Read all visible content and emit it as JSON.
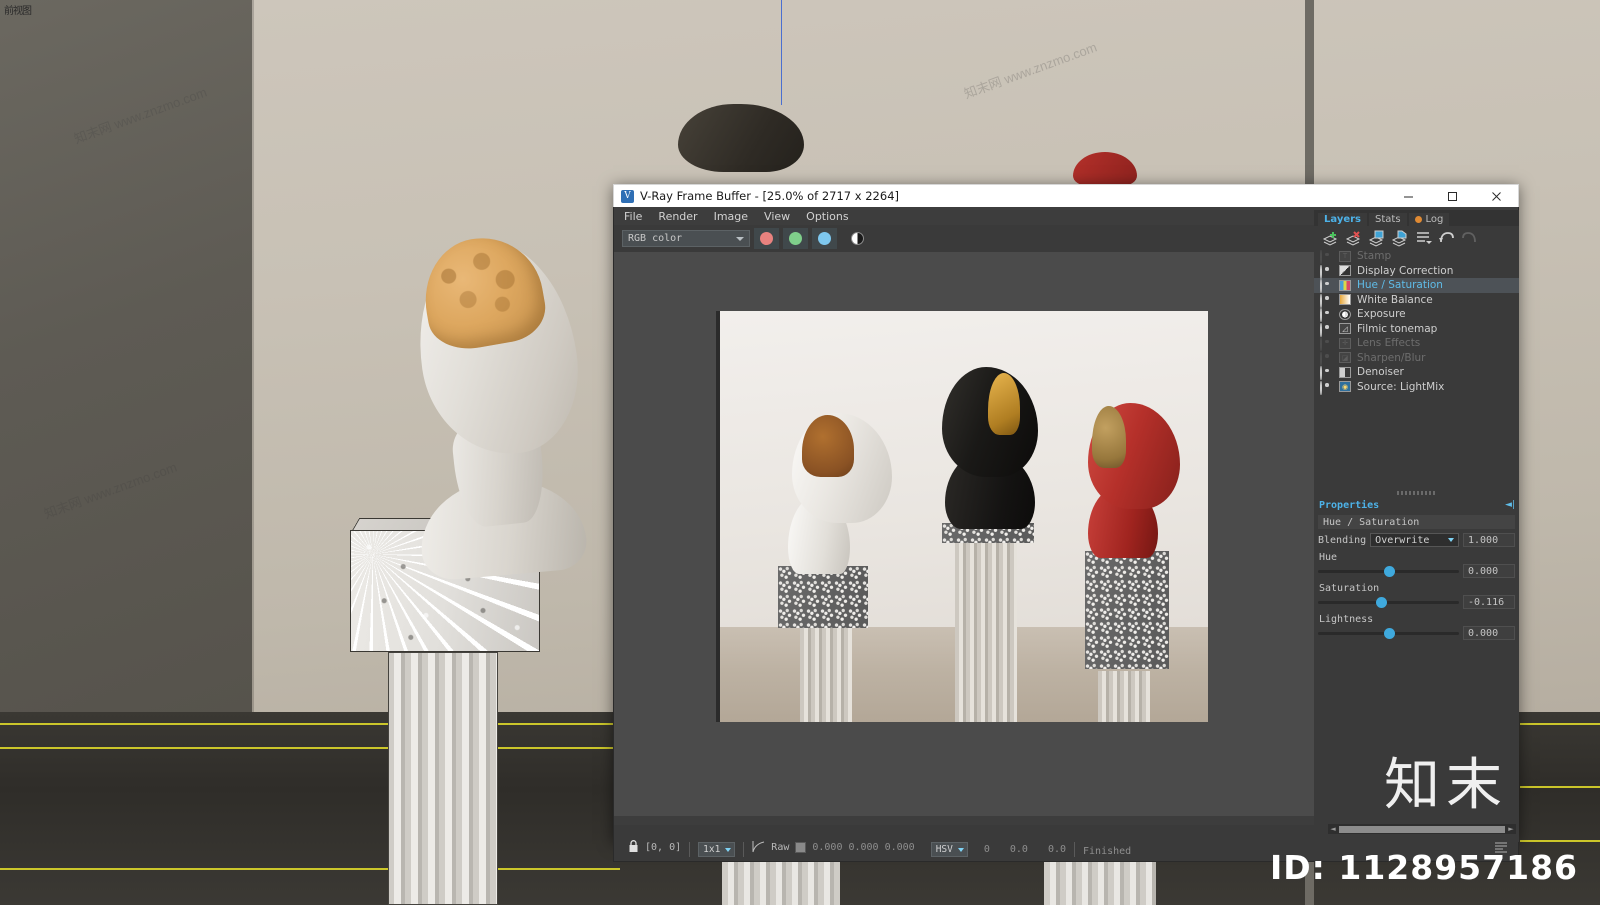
{
  "viewport": {
    "label": "前视图",
    "watermarks": [
      "知末网 www.znzmo.com",
      "知末网 www.znzmo.com",
      "知末网 www.znzmo.com",
      "知末网 www.znzmo.com"
    ],
    "brand_mark": "知末",
    "id_text": "ID: 1128957186"
  },
  "window": {
    "app_icon": "vray-logo-icon",
    "title": "V-Ray Frame Buffer - [25.0% of 2717 x 2264]",
    "controls": {
      "minimize": "–",
      "maximize": "❐",
      "close": "✕"
    }
  },
  "menubar": {
    "items": [
      {
        "label": "File"
      },
      {
        "label": "Render"
      },
      {
        "label": "Image"
      },
      {
        "label": "View"
      },
      {
        "label": "Options"
      }
    ]
  },
  "toolbar": {
    "channel_select": {
      "value": "RGB color"
    },
    "channel_buttons": [
      {
        "name": "red-channel-button",
        "color": "#e8827f"
      },
      {
        "name": "green-channel-button",
        "color": "#7fcf8b"
      },
      {
        "name": "blue-channel-button",
        "color": "#7ec8ef"
      }
    ],
    "mono_button": {
      "name": "alpha-channel-button"
    },
    "right_icons": [
      {
        "name": "save-image-icon"
      },
      {
        "name": "save-image-as-icon"
      },
      {
        "name": "region-render-icon"
      },
      {
        "name": "show-vfb-icon"
      },
      {
        "name": "render-last-icon"
      },
      {
        "name": "stop-render-icon"
      },
      {
        "name": "render-icon"
      }
    ]
  },
  "dock": {
    "tabs": [
      {
        "label": "Layers",
        "active": true
      },
      {
        "label": "Stats",
        "active": false
      },
      {
        "label": "Log",
        "active": false,
        "dot": true
      }
    ],
    "layer_toolbar": [
      {
        "name": "add-layer-icon"
      },
      {
        "name": "delete-layer-icon"
      },
      {
        "name": "load-layer-icon"
      },
      {
        "name": "save-layer-icon"
      },
      {
        "name": "layer-list-icon"
      },
      {
        "name": "undo-icon"
      },
      {
        "name": "redo-icon"
      }
    ],
    "layers": [
      {
        "label": "Stamp",
        "icon": "stamp-icon",
        "enabled": false,
        "selected": false,
        "glyph": "T"
      },
      {
        "label": "Display Correction",
        "icon": "display-correction-icon",
        "enabled": true,
        "selected": false,
        "glyph": "◤"
      },
      {
        "label": "Hue / Saturation",
        "icon": "hue-saturation-icon",
        "enabled": true,
        "selected": true,
        "glyph": "▥"
      },
      {
        "label": "White Balance",
        "icon": "white-balance-icon",
        "enabled": true,
        "selected": false,
        "glyph": "▬"
      },
      {
        "label": "Exposure",
        "icon": "exposure-icon",
        "enabled": true,
        "selected": false,
        "glyph": "◑"
      },
      {
        "label": "Filmic tonemap",
        "icon": "filmic-tonemap-icon",
        "enabled": true,
        "selected": false,
        "glyph": "◿"
      },
      {
        "label": "Lens Effects",
        "icon": "lens-effects-icon",
        "enabled": false,
        "selected": false,
        "glyph": "✛"
      },
      {
        "label": "Sharpen/Blur",
        "icon": "sharpen-blur-icon",
        "enabled": false,
        "selected": false,
        "glyph": "◪"
      },
      {
        "label": "Denoiser",
        "icon": "denoiser-icon",
        "enabled": true,
        "selected": false,
        "glyph": "◨"
      },
      {
        "label": "Source: LightMix",
        "icon": "lightmix-source-icon",
        "enabled": true,
        "selected": false,
        "glyph": "◉"
      }
    ]
  },
  "properties": {
    "title": "Properties",
    "pin_icon": "pin-icon",
    "layer_name": "Hue / Saturation",
    "blending": {
      "label": "Blending",
      "value": "Overwrite",
      "opacity": "1.000"
    },
    "sliders": [
      {
        "label": "Hue",
        "value": "0.000",
        "pct": 50
      },
      {
        "label": "Saturation",
        "value": "-0.116",
        "pct": 45
      },
      {
        "label": "Lightness",
        "value": "0.000",
        "pct": 50
      }
    ]
  },
  "statusbar": {
    "lock_icon": "lock-icon",
    "pixel_coords": "[0, 0]",
    "sample_size": "1x1",
    "curve_icon": "color-curve-icon",
    "raw_label": "Raw",
    "swatch_color": "#8a8a8a",
    "rgb_values": [
      "0.000",
      "0.000",
      "0.000"
    ],
    "color_mode": "HSV",
    "hsv_values": [
      "0",
      "0.0",
      "0.0"
    ],
    "render_status": "Finished",
    "menu_icon": "status-menu-icon"
  },
  "render_preview": {
    "description": "Three David bust sculptures on granite and fluted column pedestals",
    "busts": [
      {
        "name": "white-bust",
        "body_color": "#e8e4df",
        "hair_color": "#9a5c2a"
      },
      {
        "name": "black-bust",
        "body_color": "#1c1a18",
        "hair_color": "#c98b2a"
      },
      {
        "name": "red-bust",
        "body_color": "#b8302b",
        "hair_color": "#9d7a3c"
      }
    ]
  }
}
